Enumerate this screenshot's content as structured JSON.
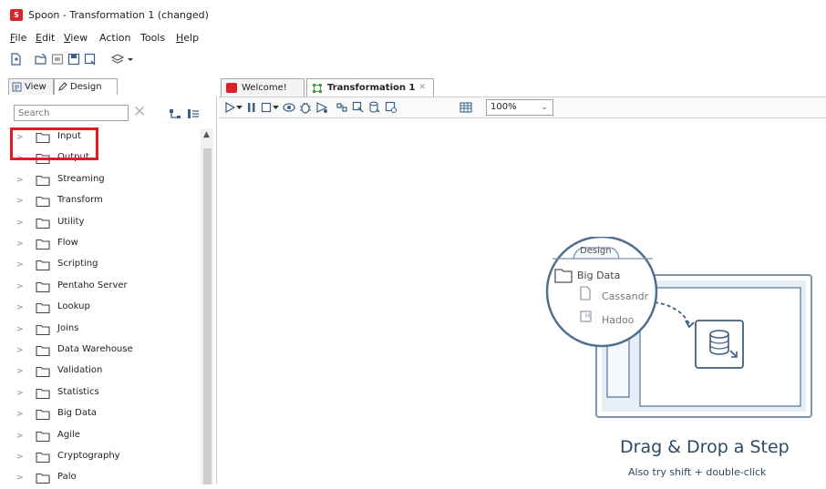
{
  "window": {
    "title": "Spoon - Transformation 1 (changed)",
    "logo_text": "S"
  },
  "menu": {
    "items": [
      {
        "first": "F",
        "rest": "ile"
      },
      {
        "first": "E",
        "rest": "dit"
      },
      {
        "first": "V",
        "rest": "iew"
      },
      {
        "first": "",
        "rest": "Action"
      },
      {
        "first": "",
        "rest": "Tools"
      },
      {
        "first": "H",
        "rest": "elp"
      }
    ]
  },
  "left_tabs": {
    "view": "View",
    "design": "Design"
  },
  "search": {
    "placeholder": "Search",
    "value": ""
  },
  "tree": {
    "items": [
      "Input",
      "Output",
      "Streaming",
      "Transform",
      "Utility",
      "Flow",
      "Scripting",
      "Pentaho Server",
      "Lookup",
      "Joins",
      "Data Warehouse",
      "Validation",
      "Statistics",
      "Big Data",
      "Agile",
      "Cryptography",
      "Palo"
    ]
  },
  "editor_tabs": {
    "welcome": "Welcome!",
    "transformation": "Transformation 1"
  },
  "canvas_toolbar": {
    "zoom": "100%"
  },
  "illustration": {
    "tab_label": "Design",
    "folder_label": "Big Data",
    "item1": "Cassandr",
    "item2": "Hadoo",
    "item2_icon_letter": "H"
  },
  "dropzone": {
    "title": "Drag & Drop a Step",
    "subtitle": "Also try shift + double-click"
  },
  "colors": {
    "accent_red": "#e31b23",
    "hint_blue": "#2e4a63",
    "illustration_stroke": "#7a94ad",
    "illustration_fill": "#e6eef6"
  }
}
